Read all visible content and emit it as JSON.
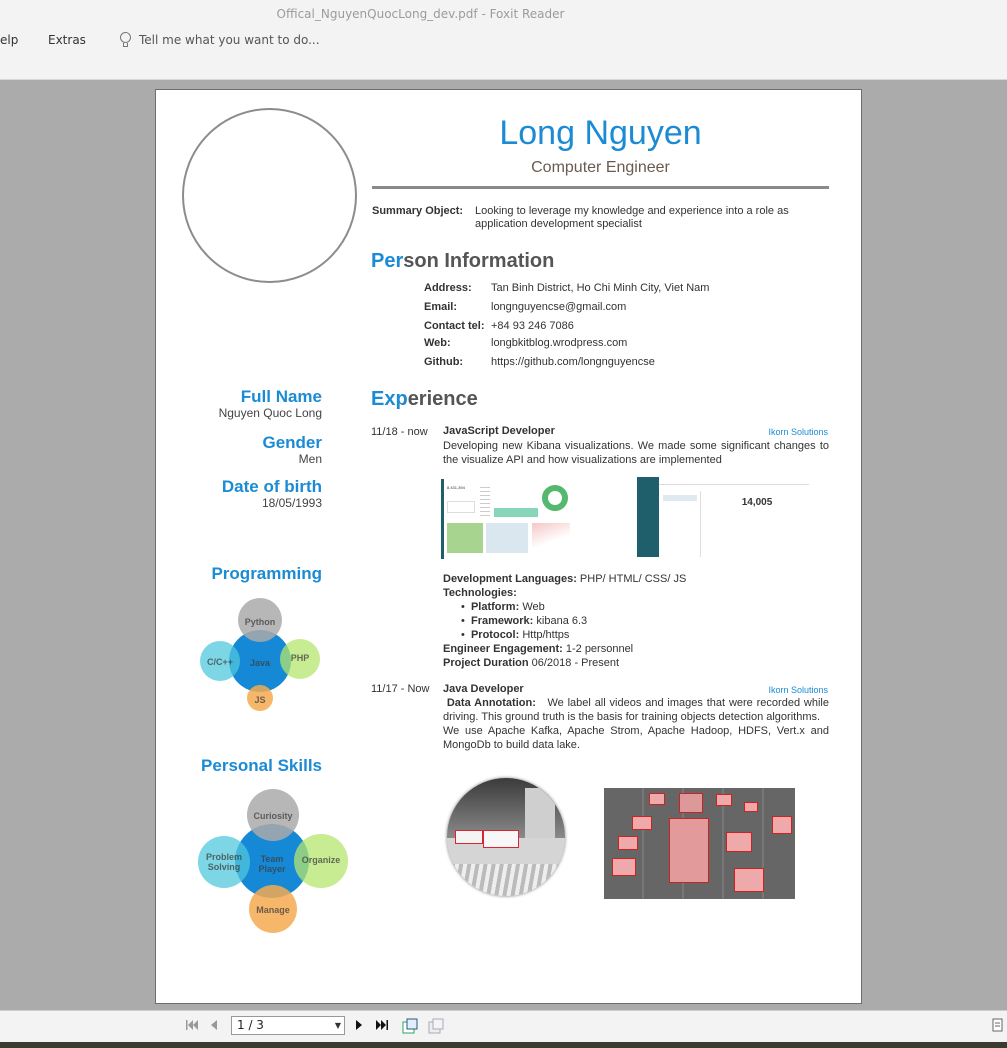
{
  "window": {
    "title": "Offical_NguyenQuocLong_dev.pdf - Foxit Reader"
  },
  "ribbon": {
    "help_tab": "elp",
    "extras_tab": "Extras",
    "tell_placeholder": "Tell me what you want to do..."
  },
  "resume": {
    "name": "Long Nguyen",
    "role": "Computer Engineer",
    "summary_label": "Summary Object:",
    "summary_text": "Looking to leverage my knowledge and experience into a role as application development specialist",
    "person_head_hl": "Per",
    "person_head_rest": "son Information",
    "info": [
      {
        "key": "Address:",
        "value": "Tan Binh District, Ho Chi Minh City, Viet Nam"
      },
      {
        "key": "Email:",
        "value": "longnguyencse@gmail.com"
      },
      {
        "key": "Contact tel:",
        "value": "+84 93 246 7086"
      },
      {
        "key": "Web:",
        "value": "longbkitblog.wrodpress.com"
      },
      {
        "key": "Github:",
        "value": "https://github.com/longnguyencse"
      }
    ],
    "sidebar": {
      "full_name_label": "Full Name",
      "full_name": "Nguyen Quoc Long",
      "gender_label": "Gender",
      "gender": "Men",
      "dob_label": "Date of birth",
      "dob": "18/05/1993",
      "programming_head": "Programming",
      "programming": {
        "center": "Java",
        "top": "Python",
        "left": "C/C++",
        "right": "PHP",
        "bottom": "JS"
      },
      "skills_head": "Personal Skills",
      "skills": {
        "center": "Team Player",
        "top": "Curiosity",
        "left": "Problem Solving",
        "right": "Organize",
        "bottom": "Manage"
      }
    },
    "experience_head_hl": "Exp",
    "experience_head_rest": "erience",
    "jobs": [
      {
        "period": "11/18 - now",
        "title": "JavaScript Developer",
        "company": "Ikorn Solutions",
        "desc": "Developing new Kibana visualizations.  We made some significant changes to the visualize API and how visualizations are implemented",
        "thumb_value": "14,005",
        "thumb_kpi": "8,431,394",
        "dev_lang_label": "Development Languages:",
        "dev_lang": "PHP/ HTML/ CSS/ JS",
        "tech_label": "Technologies:",
        "platform_label": "Platform:",
        "platform": "Web",
        "framework_label": "Framework:",
        "framework": "kibana 6.3",
        "protocol_label": "Protocol:",
        "protocol": "Http/https",
        "engagement_label": "Engineer Engagement:",
        "engagement": "1-2 personnel",
        "duration_label": "Project Duration",
        "duration": "06/2018 - Present"
      },
      {
        "period": "11/17 - Now",
        "title": "Java Developer",
        "company": "Ikorn Solutions",
        "annotation_label": "Data Annotation:",
        "desc1": "We label all videos and images that were recorded while driving.  This ground truth is the basis for training objects detection algorithms.",
        "desc2": "We use Apache Kafka, Apache Strom, Apache Hadoop, HDFS, Vert.x and MongoDb to build data lake."
      }
    ]
  },
  "toolbar_bottom": {
    "page_indicator": "1 / 3"
  },
  "colors": {
    "accent": "#1a8bd4",
    "heading": "#555555",
    "role": "#6b5a4e"
  }
}
